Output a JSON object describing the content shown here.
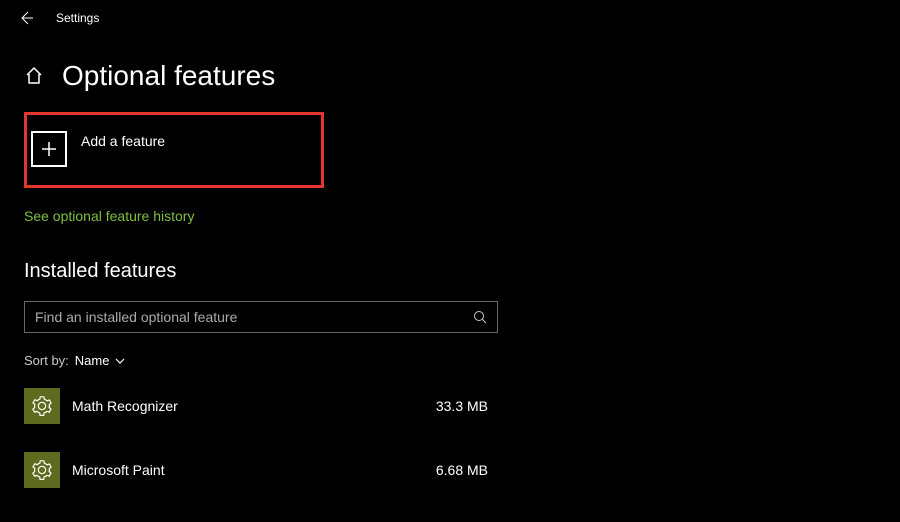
{
  "titlebar": {
    "label": "Settings"
  },
  "header": {
    "title": "Optional features"
  },
  "add_feature": {
    "label": "Add a feature"
  },
  "history_link": {
    "label": "See optional feature history"
  },
  "installed": {
    "title": "Installed features",
    "search_placeholder": "Find an installed optional feature",
    "sort_label": "Sort by:",
    "sort_value": "Name",
    "items": [
      {
        "name": "Math Recognizer",
        "size": "33.3 MB"
      },
      {
        "name": "Microsoft Paint",
        "size": "6.68 MB"
      }
    ]
  }
}
